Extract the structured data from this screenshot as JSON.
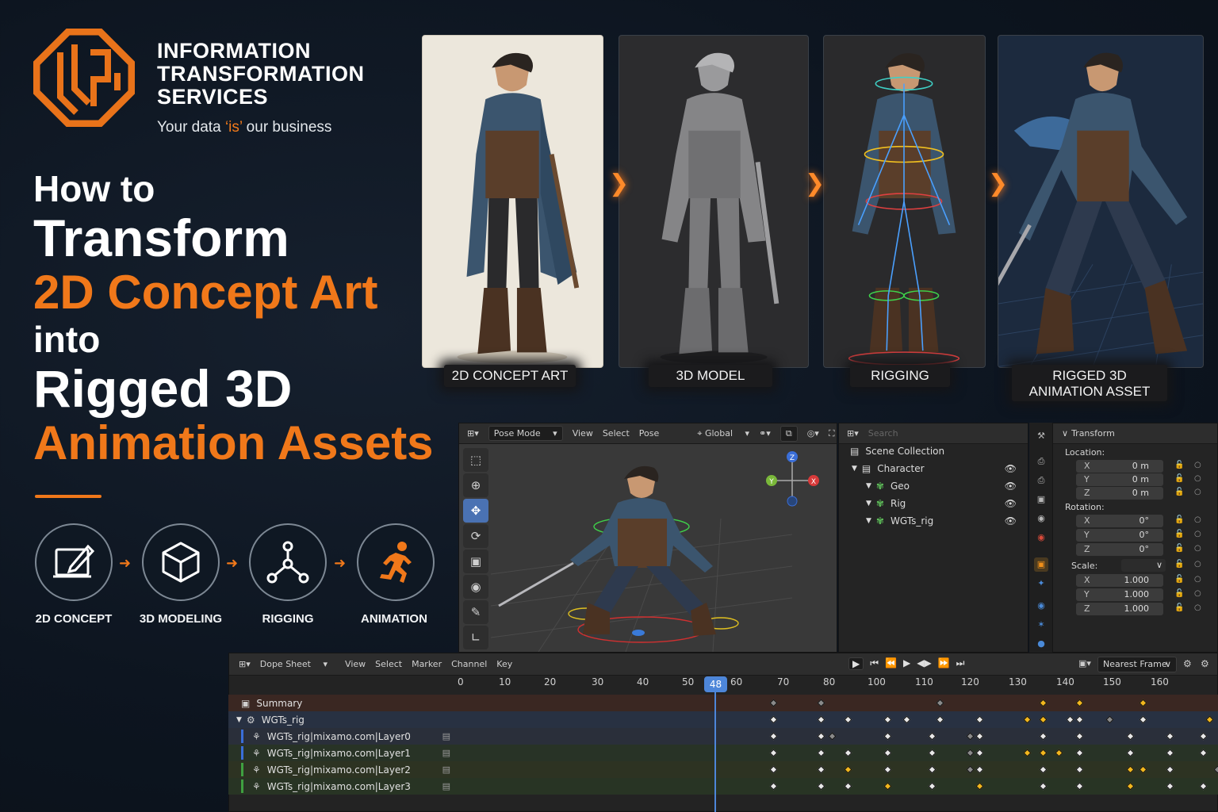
{
  "brand": {
    "name_lines": [
      "INFORMATION",
      "TRANSFORMATION",
      "SERVICES"
    ],
    "tagline_pre": "Your data ",
    "tagline_hl": "‘is’",
    "tagline_post": " our business",
    "accent": "#f0781a"
  },
  "headline": {
    "line1": "How to",
    "line2": "Transform",
    "line3": "2D Concept Art",
    "line4": "into",
    "line5": "Rigged 3D",
    "line6": "Animation Assets"
  },
  "process": [
    {
      "label": "2D CONCEPT",
      "icon": "tablet-pen-icon"
    },
    {
      "label": "3D MODELING",
      "icon": "cube-icon"
    },
    {
      "label": "RIGGING",
      "icon": "bone-joint-icon"
    },
    {
      "label": "ANIMATION",
      "icon": "running-figure-icon"
    }
  ],
  "stages": [
    {
      "label": "2D CONCEPT ART"
    },
    {
      "label": "3D MODEL"
    },
    {
      "label": "RIGGING"
    },
    {
      "label_line1": "RIGGED 3D",
      "label_line2": "ANIMATION ASSET"
    }
  ],
  "viewport": {
    "mode": "Pose Mode",
    "menus": [
      "View",
      "Select",
      "Pose"
    ],
    "orientation": "Global",
    "gizmo": {
      "x": "X",
      "y": "Y",
      "z": "Z"
    }
  },
  "outliner": {
    "search_placeholder": "Search",
    "items": [
      {
        "label": "Scene Collection"
      },
      {
        "label": "Character"
      },
      {
        "label": "Geo"
      },
      {
        "label": "Rig"
      },
      {
        "label": "WGTs_rig"
      }
    ]
  },
  "properties": {
    "panel_title": "Transform",
    "location_label": "Location:",
    "rotation_label": "Rotation:",
    "scale_label": "Scale:",
    "location": [
      {
        "axis": "X",
        "value": "0 m"
      },
      {
        "axis": "Y",
        "value": "0 m"
      },
      {
        "axis": "Z",
        "value": "0 m"
      }
    ],
    "rotation": [
      {
        "axis": "X",
        "value": "0°"
      },
      {
        "axis": "Y",
        "value": "0°"
      },
      {
        "axis": "Z",
        "value": "0°"
      }
    ],
    "scale": [
      {
        "axis": "X",
        "value": "1.000"
      },
      {
        "axis": "Y",
        "value": "1.000"
      },
      {
        "axis": "Z",
        "value": "1.000"
      }
    ]
  },
  "dopesheet": {
    "editor": "Dope Sheet",
    "menus": [
      "View",
      "Select",
      "Marker",
      "Channel",
      "Key"
    ],
    "interpolation": "Nearest Frame",
    "current_frame": "48",
    "ruler": [
      "0",
      "10",
      "20",
      "30",
      "40",
      "50",
      "60",
      "70",
      "80",
      "100",
      "110",
      "120",
      "130",
      "140",
      "150",
      "160"
    ],
    "channels": [
      {
        "name": "Summary"
      },
      {
        "name": "WGTs_rig"
      },
      {
        "name": "WGTs_rig|mixamo.com|Layer0"
      },
      {
        "name": "WGTs_rig|mixamo.com|Layer1"
      },
      {
        "name": "WGTs_rig|mixamo.com|Layer2"
      },
      {
        "name": "WGTs_rig|mixamo.com|Layer3"
      }
    ]
  }
}
